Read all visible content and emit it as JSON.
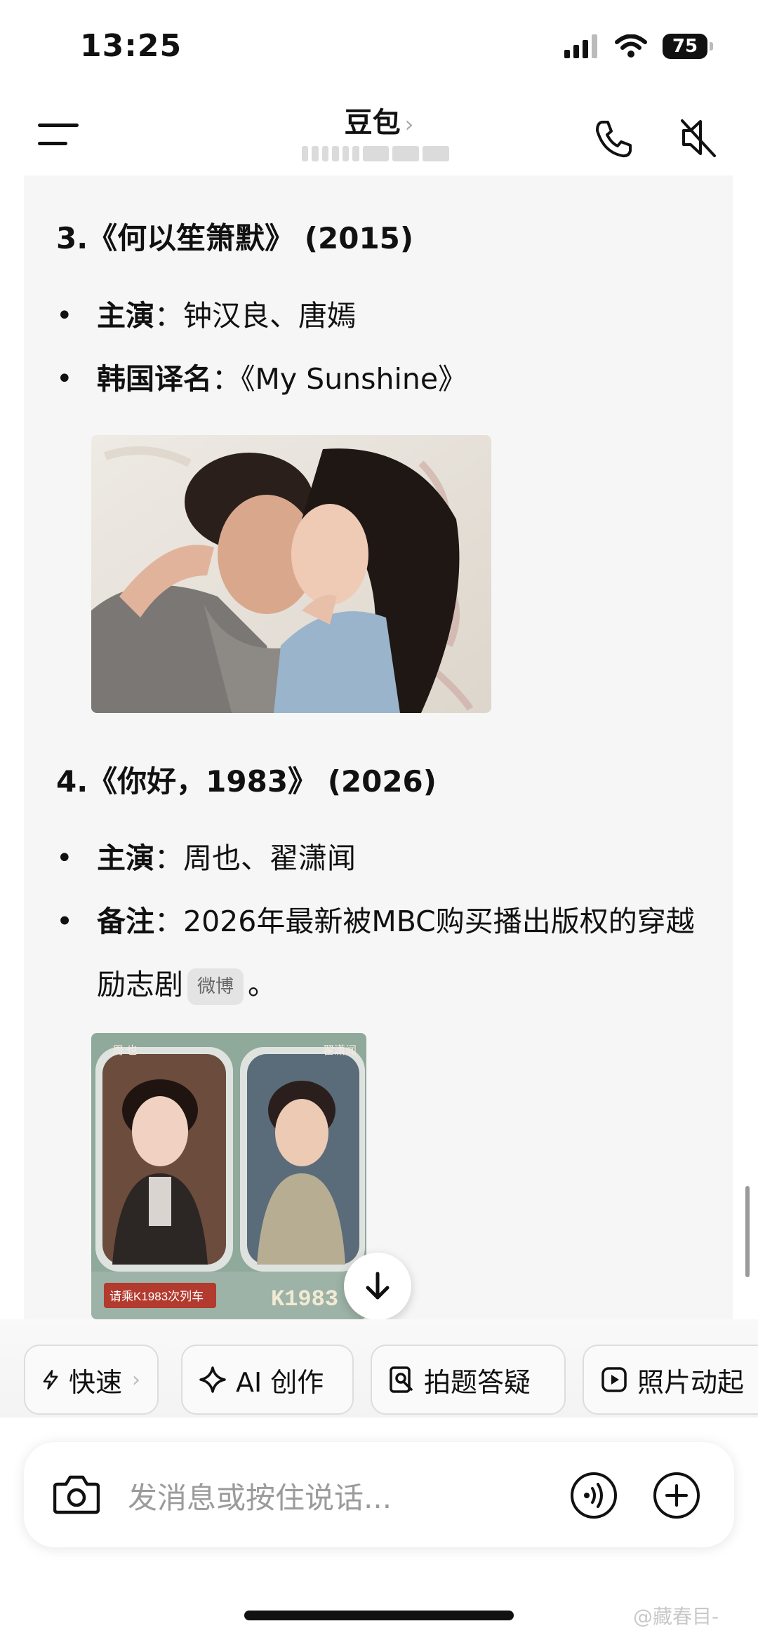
{
  "status_bar": {
    "time": "13:25",
    "battery": "75",
    "icons": [
      "signal-icon",
      "wifi-icon",
      "battery-icon"
    ]
  },
  "header": {
    "title": "豆包",
    "chevron": "›",
    "icons": [
      "menu-icon",
      "phone-icon",
      "mute-icon"
    ]
  },
  "messages": {
    "item3": {
      "title": "3.《何以笙箫默》 (2015)",
      "cast_label": "主演",
      "cast_value": "：钟汉良、唐嫣",
      "korean_label": "韩国译名",
      "korean_value": "：《My Sunshine》",
      "poster_icon": "poster-image"
    },
    "item4": {
      "title": "4.《你好，1983》 (2026)",
      "cast_label": "主演",
      "cast_value": "：周也、翟潇闻",
      "note_label": "备注",
      "note_value": "：2026年最新被MBC购买播出版权的穿越励志剧",
      "source_badge": "微博",
      "note_end": "。",
      "poster_actor_left": "周 也",
      "poster_actor_right": "翟潇闻",
      "poster_train_sign": "请乘K1983次列车",
      "poster_train_number": "K1983"
    }
  },
  "chips": [
    {
      "label": "快速",
      "icon": "bolt-icon"
    },
    {
      "label": "AI 创作",
      "icon": "sparkle-icon"
    },
    {
      "label": "拍题答疑",
      "icon": "scan-question-icon"
    },
    {
      "label": "照片动起",
      "icon": "play-icon"
    }
  ],
  "input": {
    "placeholder": "发消息或按住说话..."
  },
  "watermark": "@藏春目-",
  "colors": {
    "background": "#ffffff",
    "chat_background": "#f6f6f6",
    "text": "#111111",
    "placeholder": "#9b9b9b"
  }
}
